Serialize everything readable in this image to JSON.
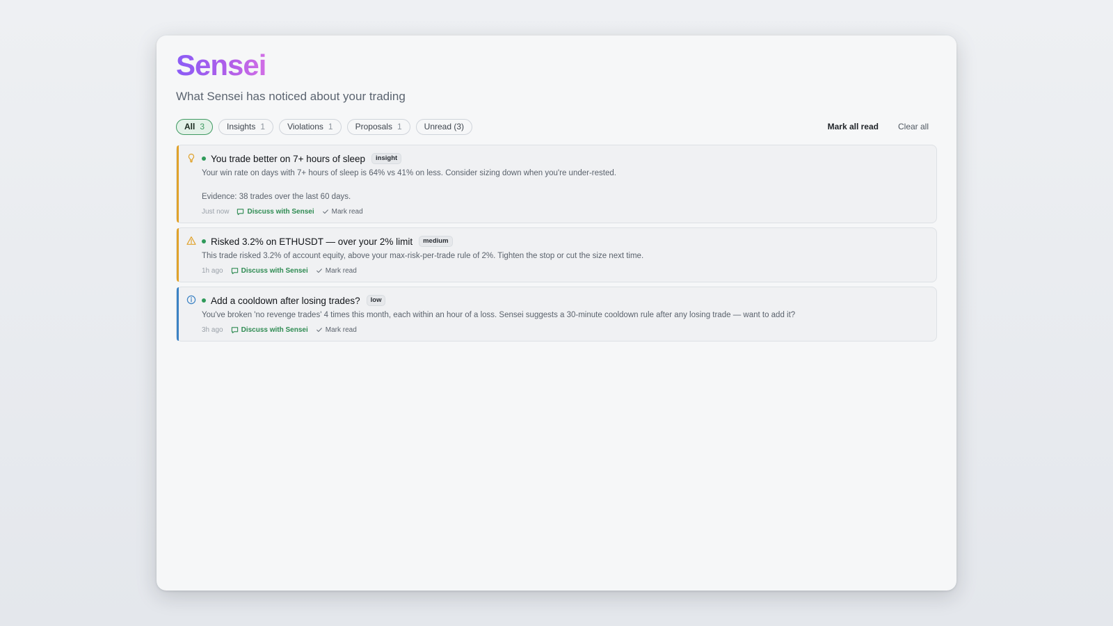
{
  "app": {
    "brand": "Sensei",
    "subtitle": "What Sensei has noticed about your trading"
  },
  "filters": [
    {
      "label": "All",
      "count": "3",
      "active": true
    },
    {
      "label": "Insights",
      "count": "1",
      "active": false
    },
    {
      "label": "Violations",
      "count": "1",
      "active": false
    },
    {
      "label": "Proposals",
      "count": "1",
      "active": false
    },
    {
      "label": "Unread (3)",
      "count": "",
      "active": false
    }
  ],
  "actions": {
    "mark_all_read": "Mark all read",
    "clear_all": "Clear all"
  },
  "notifications": [
    {
      "icon": "lightbulb-icon",
      "accent": "#e0a22b",
      "title": "You trade better on 7+ hours of sleep",
      "tag": "insight",
      "body": "Your win rate on days with 7+ hours of sleep is 64% vs 41% on less. Consider sizing down when you're under-rested.",
      "evidence": "Evidence: 38 trades over the last 60 days.",
      "time": "Just now",
      "discuss_label": "Discuss with Sensei",
      "mark_read_label": "Mark read"
    },
    {
      "icon": "warning-icon",
      "accent": "#e0a22b",
      "title": "Risked 3.2% on ETHUSDT — over your 2% limit",
      "tag": "medium",
      "body": "This trade risked 3.2% of account equity, above your max-risk-per-trade rule of 2%. Tighten the stop or cut the size next time.",
      "time": "1h ago",
      "discuss_label": "Discuss with Sensei",
      "mark_read_label": "Mark read"
    },
    {
      "icon": "info-icon",
      "accent": "#3b82c4",
      "title": "Add a cooldown after losing trades?",
      "tag": "low",
      "body": "You've broken 'no revenge trades' 4 times this month, each within an hour of a loss. Sensei suggests a 30-minute cooldown rule after any losing trade — want to add it?",
      "time": "3h ago",
      "discuss_label": "Discuss with Sensei",
      "mark_read_label": "Mark read"
    }
  ],
  "colors": {
    "brand_gradient_start": "#8b5cf6",
    "brand_gradient_end": "#d16ee6",
    "unread_dot": "#2f9a5a",
    "discuss_link": "#2e8b52",
    "active_chip_border": "#3f9a62"
  }
}
